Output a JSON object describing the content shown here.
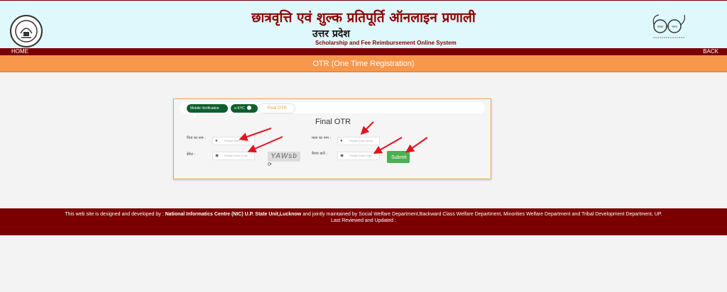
{
  "header": {
    "title_hindi": "छात्रवृत्ति एवं शुल्क प्रतिपूर्ति ऑनलाइन प्रणाली",
    "state_hindi": "उत्तर प्रदेश",
    "subtitle_english": "Scholarship and Fee Reimbursement Online System"
  },
  "nav": {
    "home": "HOME",
    "back": "BACK"
  },
  "banner": {
    "title": "OTR (One Time Registration)"
  },
  "tabs": [
    {
      "label": "Mobile Verification"
    },
    {
      "label": "e-KYC"
    },
    {
      "label": "Final OTR"
    }
  ],
  "form": {
    "title": "Final OTR",
    "father_label": "पिता का नाम :",
    "father_placeholder": "Please Enter Father",
    "mother_label": "माता का नाम :",
    "mother_placeholder": "Please Enter Moth",
    "email_label": "ईमेल :",
    "email_placeholder": "Please Enter E-Mc",
    "captcha_label": "कैप्चा डालें :",
    "captcha_placeholder": "Please Enter Capt",
    "captcha_text": "YAWsb",
    "submit_label": "Submit"
  },
  "footer": {
    "line1_prefix": "This web site is designed and developed by :",
    "line1_org": "National Informatics Centre (NIC) U.P. State Unit,Lucknow",
    "line1_suffix": "and jointly maintained by Social Welfare Department,Backward Class Welfare Department, Minorities Welfare Department and Tribal Development Department, UP.",
    "line2": "Last Reviewed and Updated :"
  },
  "colors": {
    "maroon": "#7a0000",
    "orange": "#f7974b",
    "header_bg": "#dff8fb",
    "tab_green": "#0f5e2d",
    "submit_green": "#4caf50",
    "arrow_red": "#e0141e"
  }
}
